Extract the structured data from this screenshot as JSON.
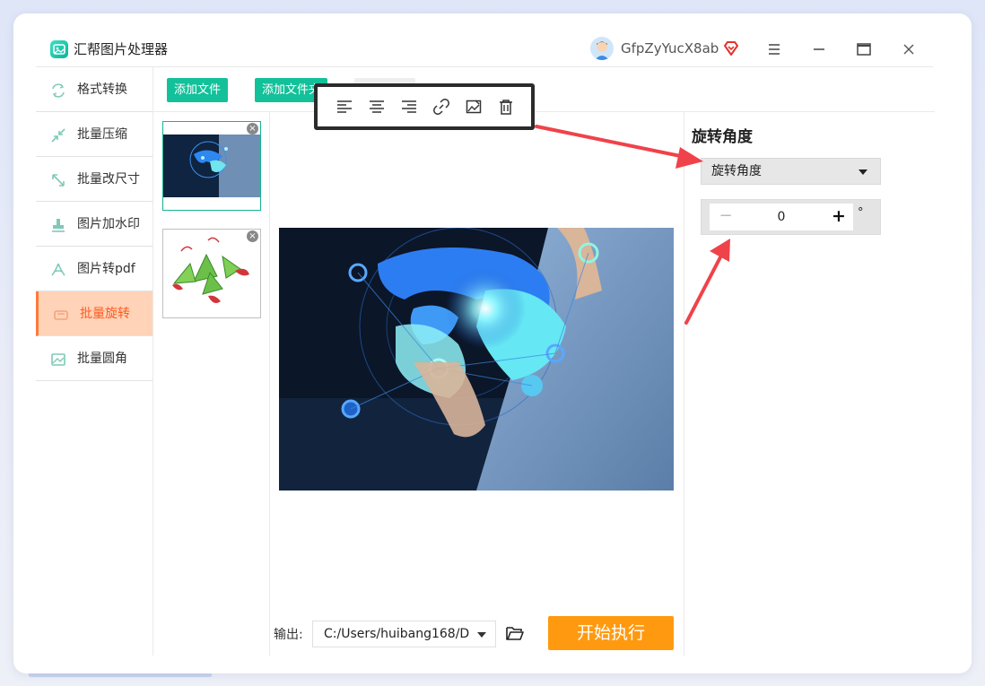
{
  "app": {
    "title": "汇帮图片处理器",
    "user": "GfpZyYucX8ab"
  },
  "sidebar": {
    "items": [
      {
        "label": "格式转换",
        "icon": "format-convert-icon"
      },
      {
        "label": "批量压缩",
        "icon": "compress-icon"
      },
      {
        "label": "批量改尺寸",
        "icon": "resize-icon"
      },
      {
        "label": "图片加水印",
        "icon": "watermark-icon"
      },
      {
        "label": "图片转pdf",
        "icon": "pdf-icon"
      },
      {
        "label": "批量旋转",
        "icon": "rotate-icon",
        "active": true
      },
      {
        "label": "批量圆角",
        "icon": "round-corner-icon"
      }
    ]
  },
  "toolbar": {
    "add_file": "添加文件",
    "add_folder": "添加文件夹"
  },
  "output": {
    "label": "输出:",
    "path": "C:/Users/huibang168/D",
    "start": "开始执行"
  },
  "settings": {
    "title": "旋转角度",
    "mode": "旋转角度",
    "angle_value": "0",
    "unit": "°"
  },
  "colors": {
    "accent": "#12c19a",
    "active_nav": "#ffd3b8",
    "active_text": "#ff5a1f",
    "start_button": "#ff9a10",
    "annotation_arrow": "#f0424a"
  }
}
